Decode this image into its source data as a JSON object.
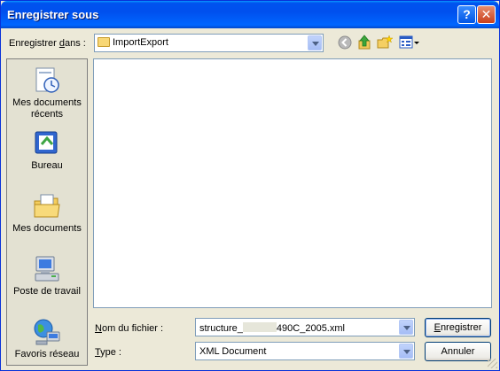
{
  "window": {
    "title": "Enregistrer sous",
    "help_label": "?",
    "close_label": "✕"
  },
  "toolbar": {
    "save_in_label_prefix": "Enregistrer ",
    "save_in_label_underlined": "d",
    "save_in_label_suffix": "ans :",
    "current_folder": "ImportExport",
    "icons": [
      "back-icon",
      "up-folder-icon",
      "new-folder-icon",
      "view-menu-icon"
    ]
  },
  "places": [
    {
      "label": "Mes documents récents",
      "icon": "recent-documents-icon"
    },
    {
      "label": "Bureau",
      "icon": "desktop-icon"
    },
    {
      "label": "Mes documents",
      "icon": "my-documents-icon"
    },
    {
      "label": "Poste de travail",
      "icon": "my-computer-icon"
    },
    {
      "label": "Favoris réseau",
      "icon": "network-places-icon"
    }
  ],
  "filename": {
    "label_underlined": "N",
    "label_rest": "om du fichier :",
    "value_prefix": "structure_",
    "value_suffix": "490C_2005.xml"
  },
  "filetype": {
    "label_underlined": "T",
    "label_rest": "ype :",
    "value": "XML Document"
  },
  "buttons": {
    "save_underlined": "E",
    "save_rest": "nregistrer",
    "cancel": "Annuler"
  },
  "colors": {
    "titlebar": "#0054e3",
    "face": "#ece9d8",
    "field_border": "#7f9db9"
  }
}
